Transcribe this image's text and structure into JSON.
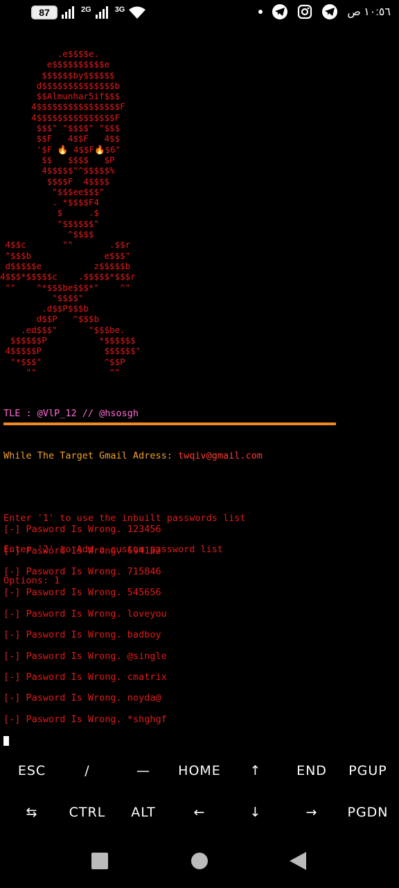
{
  "status_bar": {
    "battery": "87",
    "net_1": "2G",
    "net_2": "3G",
    "time": "١٠:٥٦ ص",
    "icons": [
      "dot-icon",
      "telegram-icon",
      "instagram-icon",
      "telegram-icon"
    ]
  },
  "terminal": {
    "ascii_art": "           .e$$$$e.\n         e$$$$$$$$$$e\n        $$$$$$by$$$$$$\n       d$$$$$$$$$$$$$$b\n       $$Almunhar5if$$$\n      4$$$$$$$$$$$$$$$$F\n      4$$$$$$$$$$$$$$$F\n       $$$\" \"$$$$\" \"$$$\n       $$F   4$$F   4$$\n       '$F 🔥 4$$F🔥$6\"\n        $$   $$$$   $P\n        4$$$$$\"^$$$$$%\n         $$$$F  4$$$$\n          \"$$$ee$$$\"\n          . *$$$$F4\n           $     .$\n           \"$$$$$$\"\n             ^$$$$\n 4$$c       \"\"       .$$r\n ^$$$b              e$$$\"\n d$$$$$e          z$$$$$b\n4$$$*$$$$$c    .$$$$$*$$$r\n \"\"    ^*$$$be$$$*\"    ^\"\n          \"$$$$\"\n        .d$$P$$$b\n       d$$P   ^$$$b\n    .ed$$$\"      \"$$$be.\n  $$$$$$P          *$$$$$$\n 4$$$$$P            $$$$$$\"\n  \"*$$$\"            ^$$P\n     \"\"              ^\"",
    "tle_line": "TLE : @VlP_12 // @hsosgh",
    "prompt_label": "While The Target Gmail Adress: ",
    "prompt_email": "twqiv@gmail.com",
    "menu_line_1": "Enter '1' to use the inbuilt passwords list",
    "menu_line_2": "Enter '2' to Add a custom password list",
    "options_line": "Options: 1",
    "attempts": [
      "[-] Pasword Is Wrong. 123456",
      "[-] Pasword Is Wrong. 694132",
      "[-] Pasword Is Wrong. 715846",
      "[-] Pasword Is Wrong. 545656",
      "[-] Pasword Is Wrong. loveyou",
      "[-] Pasword Is Wrong. badboy",
      "[-] Pasword Is Wrong. @single",
      "[-] Pasword Is Wrong. cmatrix",
      "[-] Pasword Is Wrong. noyda@",
      "[-] Pasword Is Wrong. *shghgf"
    ],
    "colors": {
      "text": "#e01a1a",
      "tle": "#ff6ad5",
      "rule": "#f08a24",
      "prompt": "#f0a030"
    }
  },
  "extra_keys": {
    "row1": [
      "ESC",
      "/",
      "—",
      "HOME",
      "↑",
      "END",
      "PGUP"
    ],
    "row2": [
      "⇆",
      "CTRL",
      "ALT",
      "←",
      "↓",
      "→",
      "PGDN"
    ]
  },
  "nav_bar": [
    "recents-square-icon",
    "home-circle-icon",
    "back-triangle-icon"
  ]
}
